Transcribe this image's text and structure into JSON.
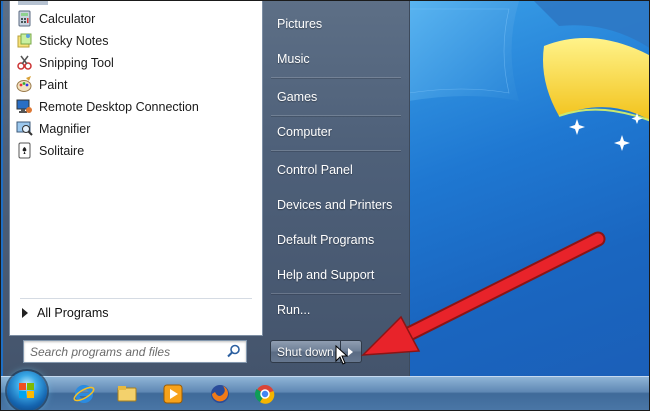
{
  "start_menu": {
    "programs": [
      {
        "label": "Calculator",
        "icon": "calculator-icon"
      },
      {
        "label": "Sticky Notes",
        "icon": "sticky-notes-icon"
      },
      {
        "label": "Snipping Tool",
        "icon": "snipping-tool-icon"
      },
      {
        "label": "Paint",
        "icon": "paint-icon"
      },
      {
        "label": "Remote Desktop Connection",
        "icon": "remote-desktop-icon"
      },
      {
        "label": "Magnifier",
        "icon": "magnifier-icon"
      },
      {
        "label": "Solitaire",
        "icon": "solitaire-icon"
      }
    ],
    "all_programs_label": "All Programs",
    "search_placeholder": "Search programs and files",
    "right_items": [
      "Pictures",
      "Music",
      "Games",
      "Computer",
      "Control Panel",
      "Devices and Printers",
      "Default Programs",
      "Help and Support",
      "Run..."
    ],
    "shutdown_label": "Shut down"
  },
  "taskbar": {
    "pinned": [
      "internet-explorer-icon",
      "file-explorer-icon",
      "media-player-icon",
      "firefox-icon",
      "chrome-icon"
    ]
  },
  "colors": {
    "arrow": "#e8232a",
    "desktop": "#1f78d2"
  }
}
